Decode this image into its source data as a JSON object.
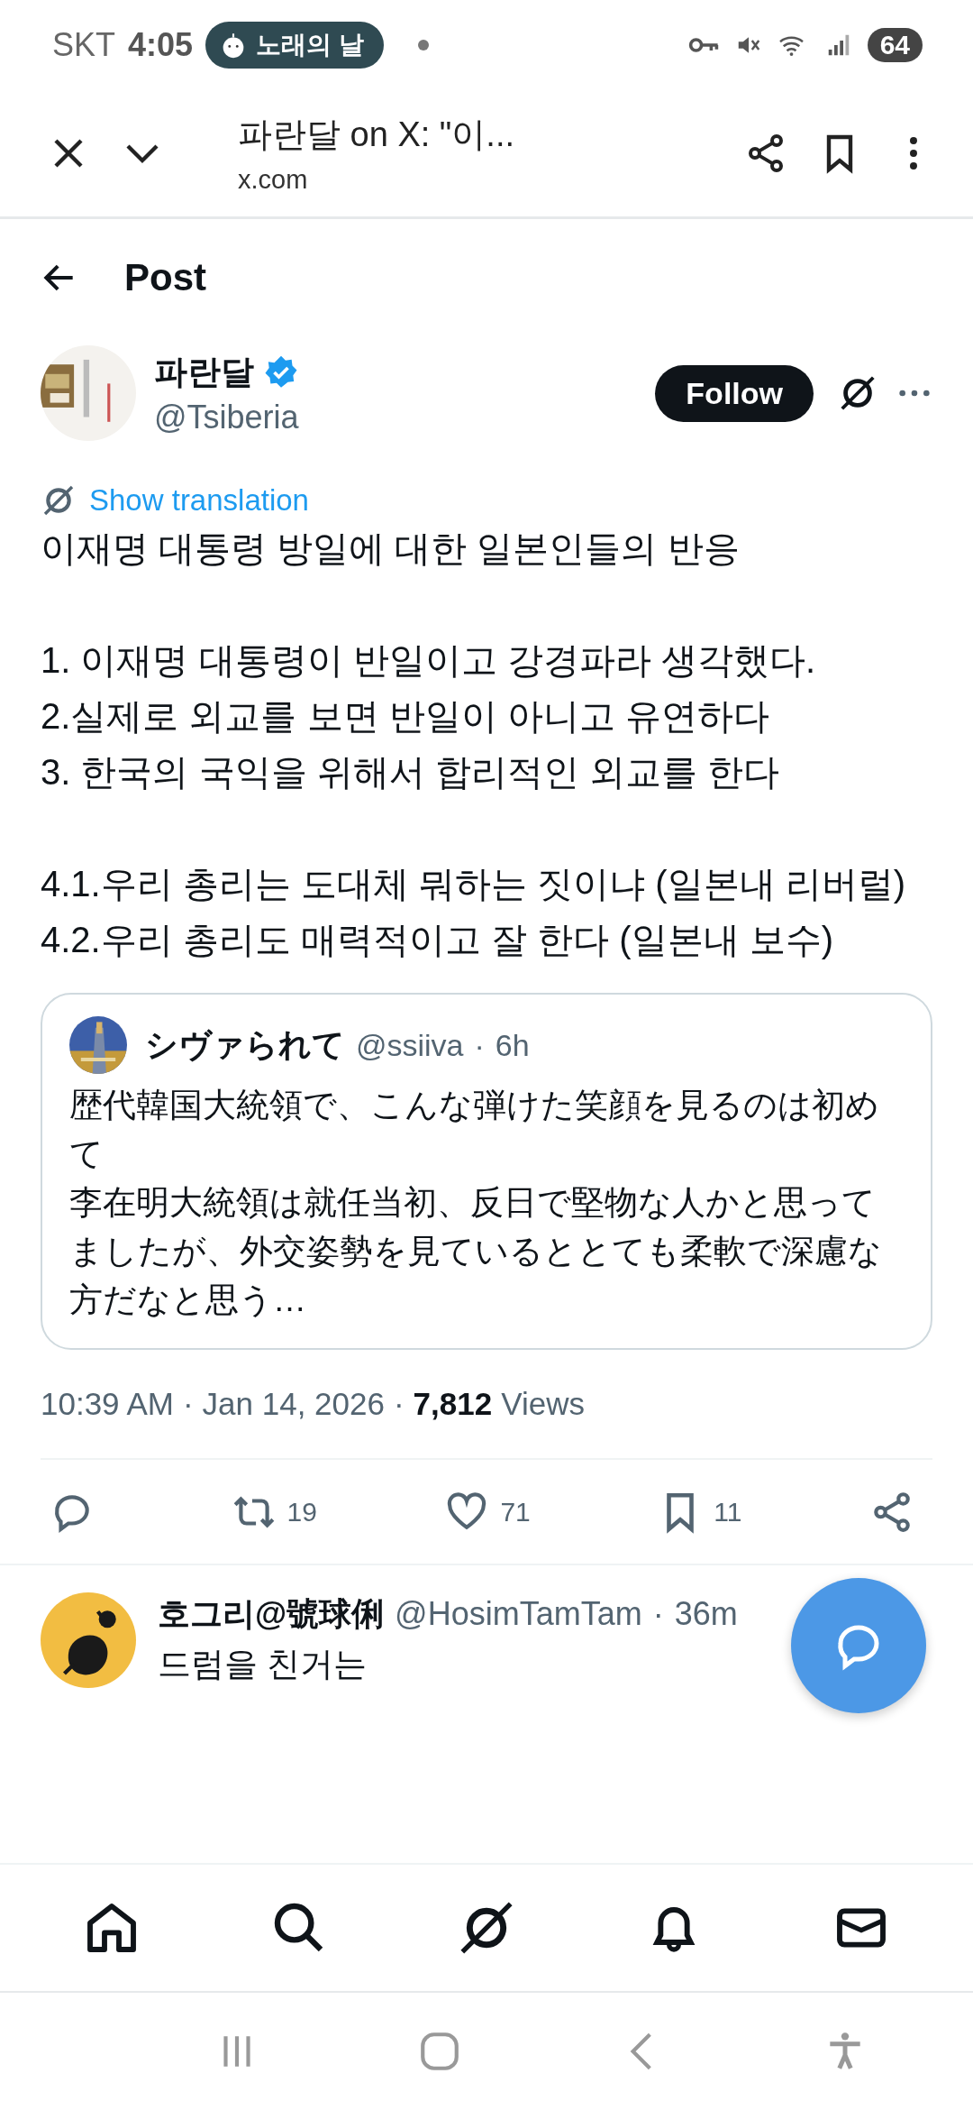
{
  "status_bar": {
    "carrier": "SKT",
    "time": "4:05",
    "notification": "노래의 날",
    "battery": "64"
  },
  "browser_bar": {
    "title": "파란달 on X: \"이...",
    "url": "x.com"
  },
  "header": {
    "title": "Post"
  },
  "post": {
    "author": "파란달",
    "verified": true,
    "handle": "@Tsiberia",
    "follow_label": "Follow",
    "translation_label": "Show translation",
    "text": "이재명 대통령 방일에 대한 일본인들의  반응\n\n1. 이재명 대통령이 반일이고 강경파라 생각했다.\n2.실제로 외교를 보면 반일이 아니고 유연하다\n3. 한국의 국익을 위해서 합리적인 외교를 한다\n\n4.1.우리 총리는 도대체 뭐하는 짓이냐 (일본내 리버럴)\n4.2.우리 총리도 매력적이고 잘 한다 (일본내 보수)"
  },
  "quote": {
    "author": "シヴァられて",
    "handle": "@ssiiva",
    "separator": "·",
    "time": "6h",
    "paragraphs": [
      "歴代韓国大統領で、こんな弾けた笑顔を見るのは初めて",
      "李在明大統領は就任当初、反日で堅物な人かと思ってましたが、外交姿勢を見ているととても柔軟で深慮な方だなと思う…"
    ]
  },
  "meta": {
    "time": "10:39 AM",
    "separator": "·",
    "date": "Jan 14, 2026",
    "views_count": "7,812",
    "views_label": "Views"
  },
  "actions": [
    {
      "kind": "reply"
    },
    {
      "kind": "repost",
      "count": "19"
    },
    {
      "kind": "like",
      "count": "71"
    },
    {
      "kind": "bookmark",
      "count": "11"
    },
    {
      "kind": "share"
    }
  ],
  "reply": {
    "author": "호그리@號球俐",
    "handle": "@HosimTamTam",
    "separator": "·",
    "time": "36m",
    "text": "드럼을 친거는"
  },
  "bottom_nav": [
    {
      "kind": "home"
    },
    {
      "kind": "search"
    },
    {
      "kind": "grok"
    },
    {
      "kind": "notifications"
    },
    {
      "kind": "messages"
    }
  ]
}
